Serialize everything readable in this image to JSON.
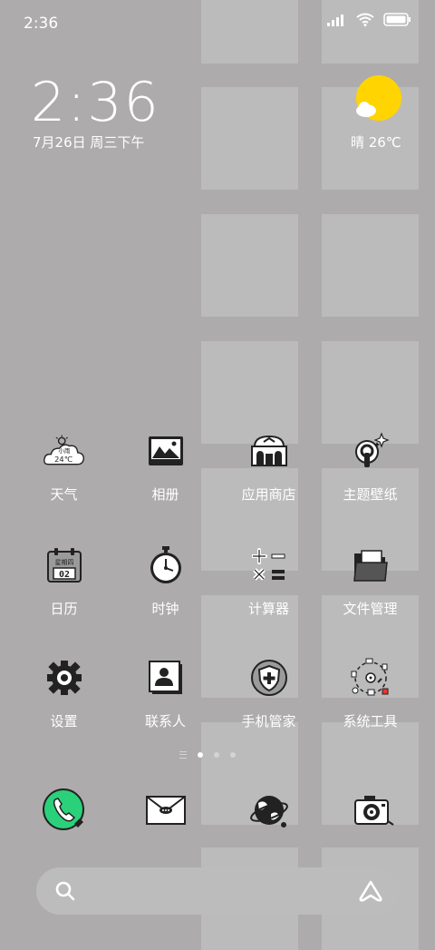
{
  "status_bar": {
    "time": "2:36"
  },
  "clock_widget": {
    "time": "2:36",
    "date": "7月26日 周三下午"
  },
  "weather_widget": {
    "summary": "晴 26℃"
  },
  "apps": [
    {
      "label": "天气",
      "icon": "weather-icon",
      "icon_text_top": "小雨",
      "icon_text_bottom": "24℃"
    },
    {
      "label": "相册",
      "icon": "gallery-icon"
    },
    {
      "label": "应用商店",
      "icon": "app-store-icon"
    },
    {
      "label": "主题壁纸",
      "icon": "themes-icon"
    },
    {
      "label": "日历",
      "icon": "calendar-icon",
      "icon_text_top": "星期四",
      "icon_text_bottom": "02"
    },
    {
      "label": "时钟",
      "icon": "clock-icon"
    },
    {
      "label": "计算器",
      "icon": "calculator-icon"
    },
    {
      "label": "文件管理",
      "icon": "file-manager-icon"
    },
    {
      "label": "设置",
      "icon": "settings-icon"
    },
    {
      "label": "联系人",
      "icon": "contacts-icon"
    },
    {
      "label": "手机管家",
      "icon": "security-icon"
    },
    {
      "label": "系统工具",
      "icon": "system-tools-icon"
    }
  ],
  "page_indicator": {
    "pages": 3,
    "active": 0
  },
  "dock": [
    {
      "name": "phone-icon",
      "color": "#2bd17a"
    },
    {
      "name": "messages-icon"
    },
    {
      "name": "browser-icon"
    },
    {
      "name": "camera-icon"
    }
  ],
  "colors": {
    "background": "#adabab",
    "sun": "#ffd400",
    "text": "#ffffff"
  }
}
